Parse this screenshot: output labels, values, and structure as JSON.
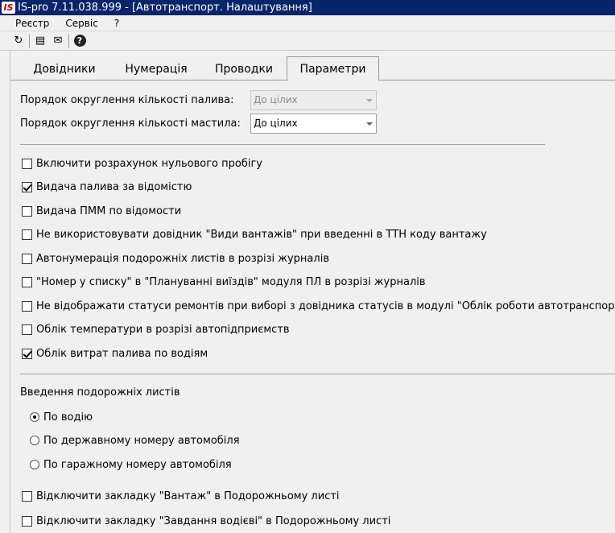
{
  "window": {
    "app_logo": "IS",
    "title": "IS-pro 7.11.038.999 - [Автотранспорт. Налаштування]"
  },
  "menu": [
    {
      "label": "Реєстр"
    },
    {
      "label": "Сервіс"
    },
    {
      "label": "?"
    }
  ],
  "toolbar": {
    "refresh_icon": "↻",
    "document_icon": "▤",
    "mail_icon": "✉",
    "help_icon": "?"
  },
  "tabs": [
    {
      "label": "Довідники",
      "active": false
    },
    {
      "label": "Нумерація",
      "active": false
    },
    {
      "label": "Проводки",
      "active": false
    },
    {
      "label": "Параметри",
      "active": true
    }
  ],
  "rounding": {
    "fuel_label": "Порядок округлення кількості палива:",
    "fuel_value": "До цілих",
    "fuel_enabled": false,
    "oil_label": "Порядок округлення кількості мастила:",
    "oil_value": "До цілих",
    "oil_enabled": true
  },
  "options": [
    {
      "label": "Включити розрахунок нульового пробігу",
      "checked": false
    },
    {
      "label": "Видача палива за відомістю",
      "checked": true
    },
    {
      "label": "Видача ПММ по відомости",
      "checked": false
    },
    {
      "label": "Не використовувати довідник \"Види вантажів\" при введенні в ТТН коду вантажу",
      "checked": false
    },
    {
      "label": "Автонумерація подорожніх листів в розрізі журналів",
      "checked": false
    },
    {
      "label": "\"Номер у списку\" в \"Плануванні виїздів\" модуля ПЛ в розрізі журналів",
      "checked": false
    },
    {
      "label": "Не відображати статуси ремонтів при виборі з довідника статусів в модулі \"Облік роботи автотранспорту\"",
      "checked": false
    },
    {
      "label": "Облік температури в розрізі автопідприємств",
      "checked": false
    },
    {
      "label": "Облік витрат палива по водіям",
      "checked": true
    }
  ],
  "waybill_entry": {
    "title": "Введення подорожніх листів",
    "choices": [
      {
        "label": "По водію",
        "selected": true
      },
      {
        "label": "По державному номеру автомобіля",
        "selected": false
      },
      {
        "label": "По гаражному номеру автомобіля",
        "selected": false
      }
    ]
  },
  "bottom_options": [
    {
      "label": "Відключити закладку \"Вантаж\" в Подорожньому листі",
      "checked": false
    },
    {
      "label": "Відключити закладку \"Завдання водієві\" в Подорожньому листі",
      "checked": false
    }
  ]
}
